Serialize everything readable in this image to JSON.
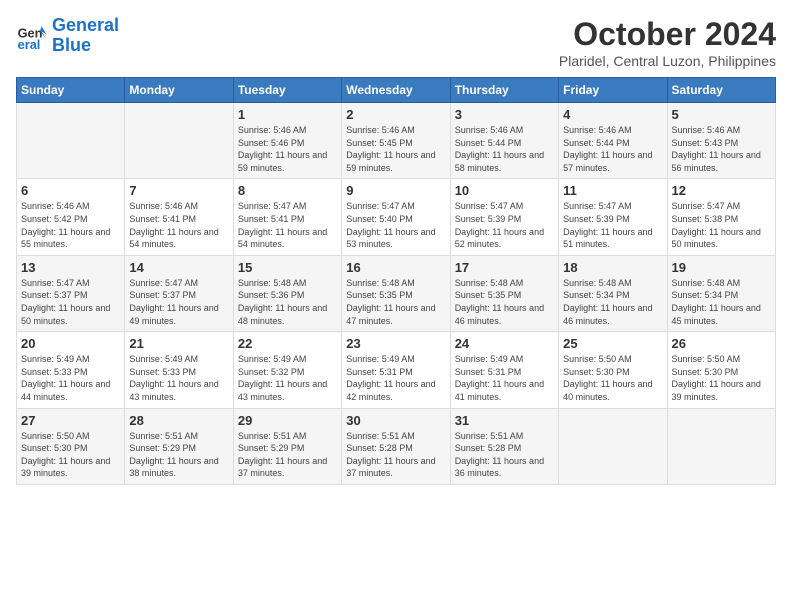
{
  "logo": {
    "line1": "General",
    "line2": "Blue"
  },
  "title": "October 2024",
  "location": "Plaridel, Central Luzon, Philippines",
  "weekdays": [
    "Sunday",
    "Monday",
    "Tuesday",
    "Wednesday",
    "Thursday",
    "Friday",
    "Saturday"
  ],
  "weeks": [
    [
      {
        "day": "",
        "content": ""
      },
      {
        "day": "",
        "content": ""
      },
      {
        "day": "1",
        "content": "Sunrise: 5:46 AM\nSunset: 5:46 PM\nDaylight: 11 hours and 59 minutes."
      },
      {
        "day": "2",
        "content": "Sunrise: 5:46 AM\nSunset: 5:45 PM\nDaylight: 11 hours and 59 minutes."
      },
      {
        "day": "3",
        "content": "Sunrise: 5:46 AM\nSunset: 5:44 PM\nDaylight: 11 hours and 58 minutes."
      },
      {
        "day": "4",
        "content": "Sunrise: 5:46 AM\nSunset: 5:44 PM\nDaylight: 11 hours and 57 minutes."
      },
      {
        "day": "5",
        "content": "Sunrise: 5:46 AM\nSunset: 5:43 PM\nDaylight: 11 hours and 56 minutes."
      }
    ],
    [
      {
        "day": "6",
        "content": "Sunrise: 5:46 AM\nSunset: 5:42 PM\nDaylight: 11 hours and 55 minutes."
      },
      {
        "day": "7",
        "content": "Sunrise: 5:46 AM\nSunset: 5:41 PM\nDaylight: 11 hours and 54 minutes."
      },
      {
        "day": "8",
        "content": "Sunrise: 5:47 AM\nSunset: 5:41 PM\nDaylight: 11 hours and 54 minutes."
      },
      {
        "day": "9",
        "content": "Sunrise: 5:47 AM\nSunset: 5:40 PM\nDaylight: 11 hours and 53 minutes."
      },
      {
        "day": "10",
        "content": "Sunrise: 5:47 AM\nSunset: 5:39 PM\nDaylight: 11 hours and 52 minutes."
      },
      {
        "day": "11",
        "content": "Sunrise: 5:47 AM\nSunset: 5:39 PM\nDaylight: 11 hours and 51 minutes."
      },
      {
        "day": "12",
        "content": "Sunrise: 5:47 AM\nSunset: 5:38 PM\nDaylight: 11 hours and 50 minutes."
      }
    ],
    [
      {
        "day": "13",
        "content": "Sunrise: 5:47 AM\nSunset: 5:37 PM\nDaylight: 11 hours and 50 minutes."
      },
      {
        "day": "14",
        "content": "Sunrise: 5:47 AM\nSunset: 5:37 PM\nDaylight: 11 hours and 49 minutes."
      },
      {
        "day": "15",
        "content": "Sunrise: 5:48 AM\nSunset: 5:36 PM\nDaylight: 11 hours and 48 minutes."
      },
      {
        "day": "16",
        "content": "Sunrise: 5:48 AM\nSunset: 5:35 PM\nDaylight: 11 hours and 47 minutes."
      },
      {
        "day": "17",
        "content": "Sunrise: 5:48 AM\nSunset: 5:35 PM\nDaylight: 11 hours and 46 minutes."
      },
      {
        "day": "18",
        "content": "Sunrise: 5:48 AM\nSunset: 5:34 PM\nDaylight: 11 hours and 46 minutes."
      },
      {
        "day": "19",
        "content": "Sunrise: 5:48 AM\nSunset: 5:34 PM\nDaylight: 11 hours and 45 minutes."
      }
    ],
    [
      {
        "day": "20",
        "content": "Sunrise: 5:49 AM\nSunset: 5:33 PM\nDaylight: 11 hours and 44 minutes."
      },
      {
        "day": "21",
        "content": "Sunrise: 5:49 AM\nSunset: 5:33 PM\nDaylight: 11 hours and 43 minutes."
      },
      {
        "day": "22",
        "content": "Sunrise: 5:49 AM\nSunset: 5:32 PM\nDaylight: 11 hours and 43 minutes."
      },
      {
        "day": "23",
        "content": "Sunrise: 5:49 AM\nSunset: 5:31 PM\nDaylight: 11 hours and 42 minutes."
      },
      {
        "day": "24",
        "content": "Sunrise: 5:49 AM\nSunset: 5:31 PM\nDaylight: 11 hours and 41 minutes."
      },
      {
        "day": "25",
        "content": "Sunrise: 5:50 AM\nSunset: 5:30 PM\nDaylight: 11 hours and 40 minutes."
      },
      {
        "day": "26",
        "content": "Sunrise: 5:50 AM\nSunset: 5:30 PM\nDaylight: 11 hours and 39 minutes."
      }
    ],
    [
      {
        "day": "27",
        "content": "Sunrise: 5:50 AM\nSunset: 5:30 PM\nDaylight: 11 hours and 39 minutes."
      },
      {
        "day": "28",
        "content": "Sunrise: 5:51 AM\nSunset: 5:29 PM\nDaylight: 11 hours and 38 minutes."
      },
      {
        "day": "29",
        "content": "Sunrise: 5:51 AM\nSunset: 5:29 PM\nDaylight: 11 hours and 37 minutes."
      },
      {
        "day": "30",
        "content": "Sunrise: 5:51 AM\nSunset: 5:28 PM\nDaylight: 11 hours and 37 minutes."
      },
      {
        "day": "31",
        "content": "Sunrise: 5:51 AM\nSunset: 5:28 PM\nDaylight: 11 hours and 36 minutes."
      },
      {
        "day": "",
        "content": ""
      },
      {
        "day": "",
        "content": ""
      }
    ]
  ]
}
